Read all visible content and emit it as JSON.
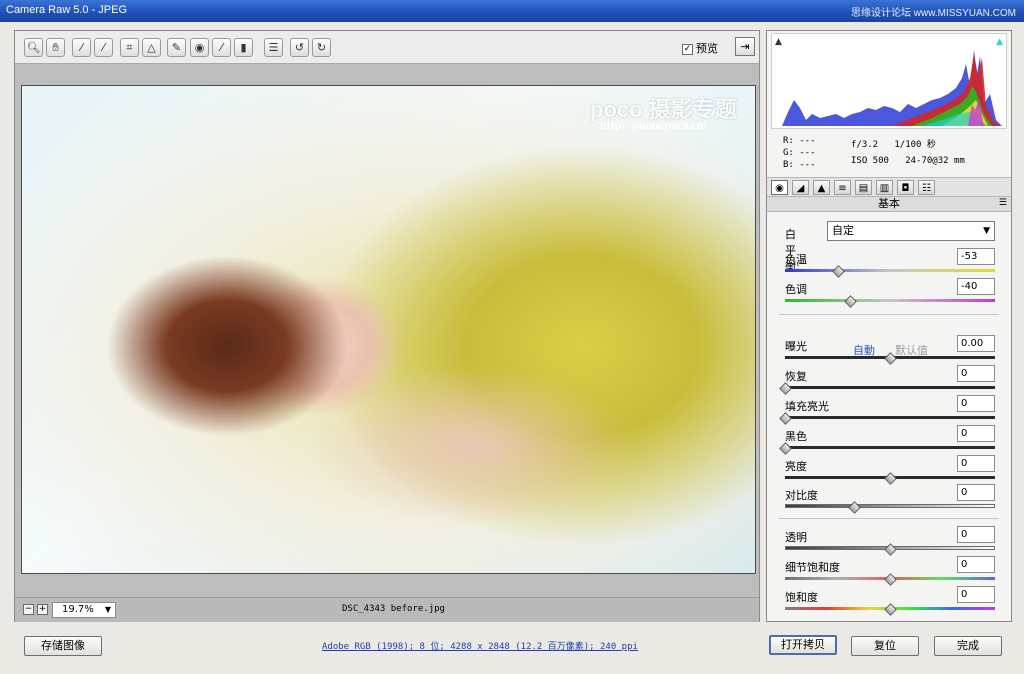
{
  "window": {
    "title": "Camera Raw 5.0 -  JPEG",
    "watermark": "思缘设计论坛 www.MISSYUAN.COM"
  },
  "toolbar": {
    "preview_label": "预览",
    "preview_checked": "✓"
  },
  "photo": {
    "logo": "poco 摄影专题",
    "logo_url": "http://photo.poco.cn/"
  },
  "status": {
    "zoom": "19.7%",
    "filename": "DSC_4343 before.jpg"
  },
  "histogram": {
    "r": "R:  ---",
    "g": "G:  ---",
    "b": "B:  ---",
    "aperture": "f/3.2",
    "shutter": "1/100 秒",
    "iso": "ISO 500",
    "lens": "24-70@32 mm"
  },
  "panel": {
    "title": "基本",
    "wb_label": "白平衡:",
    "wb_value": "自定",
    "auto": "自動",
    "default": "默认值",
    "sliders": [
      {
        "label": "色温",
        "value": "-53",
        "position": 0.25
      },
      {
        "label": "色调",
        "value": "-40",
        "position": 0.31
      },
      {
        "label": "曝光",
        "value": "0.00",
        "position": 0.5
      },
      {
        "label": "恢复",
        "value": "0",
        "position": 0.0
      },
      {
        "label": "填充亮光",
        "value": "0",
        "position": 0.0
      },
      {
        "label": "黑色",
        "value": "0",
        "position": 0.0
      },
      {
        "label": "亮度",
        "value": "0",
        "position": 0.5
      },
      {
        "label": "对比度",
        "value": "0",
        "position": 0.33
      },
      {
        "label": "透明",
        "value": "0",
        "position": 0.5
      },
      {
        "label": "细节饱和度",
        "value": "0",
        "position": 0.5
      },
      {
        "label": "饱和度",
        "value": "0",
        "position": 0.5
      }
    ]
  },
  "footer": {
    "save": "存储图像",
    "workflow": "Adobe RGB (1998); 8 位; 4288 x 2848 (12.2 百万像素); 240 ppi",
    "open_copy": "打开拷贝",
    "reset": "复位",
    "done": "完成"
  }
}
